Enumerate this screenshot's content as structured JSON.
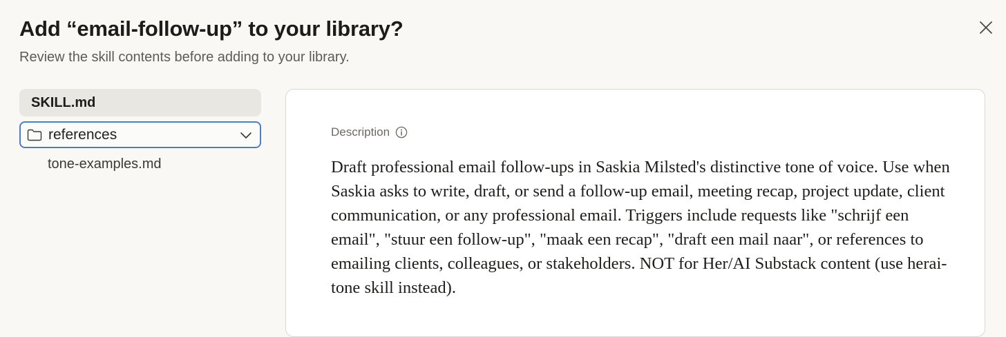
{
  "dialog": {
    "title": "Add “email-follow-up” to your library?",
    "subtitle": "Review the skill contents before adding to your library."
  },
  "sidebar": {
    "file": "SKILL.md",
    "folder": "references",
    "sub_file": "tone-examples.md"
  },
  "content": {
    "label": "Description",
    "description": "Draft professional email follow-ups in Saskia Milsted's distinctive tone of voice. Use when Saskia asks to write, draft, or send a follow-up email, meeting recap, project update, client communication, or any professional email. Triggers include requests like \"schrijf een email\", \"stuur een follow-up\", \"maak een recap\", \"draft een mail naar\", or references to emailing clients, colleagues, or stakeholders. NOT for Her/AI Substack content (use herai-tone skill instead)."
  },
  "icons": {
    "close": "close-icon",
    "folder": "folder-icon",
    "chevron": "chevron-down-icon",
    "info": "info-icon"
  },
  "colors": {
    "background": "#f9f8f5",
    "selected_item": "#e9e7e1",
    "focus_border": "#4a7fc1",
    "panel": "#ffffff"
  }
}
